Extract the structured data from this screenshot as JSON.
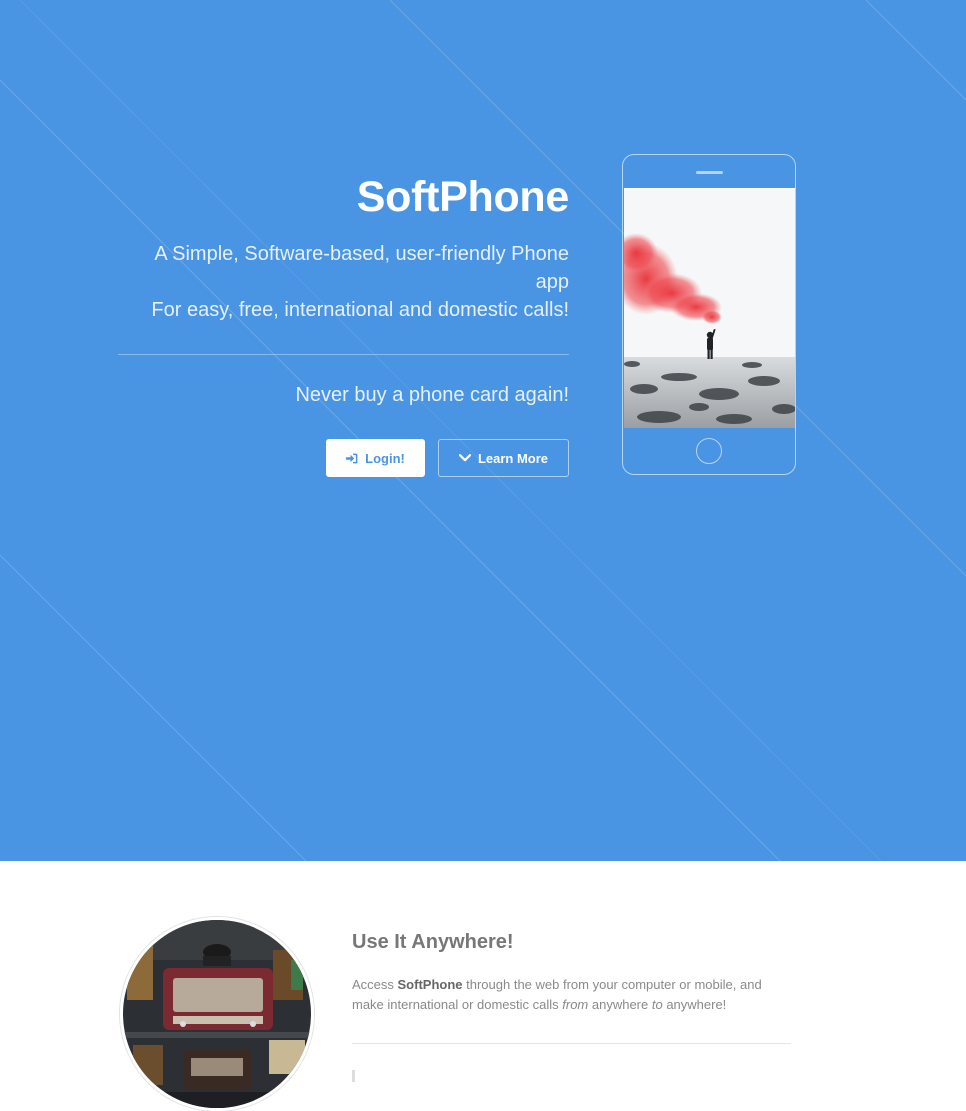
{
  "hero": {
    "title": "SoftPhone",
    "subtitle_line1": "A Simple, Software-based, user-friendly Phone app",
    "subtitle_line2": "For easy, free, international and domestic calls!",
    "tagline": "Never buy a phone card again!",
    "login_label": "Login!",
    "learn_more_label": "Learn More",
    "login_icon": "sign-in-icon",
    "learn_more_icon": "chevron-down-icon"
  },
  "feature": {
    "heading": "Use It Anywhere!",
    "body_part1": "Access ",
    "body_brand": "SoftPhone",
    "body_part2": " through the web from your computer or mobile, and make international or domestic calls ",
    "body_from": "from",
    "body_part3": " anywhere ",
    "body_to": "to",
    "body_part4": " anywhere!"
  },
  "colors": {
    "hero_background": "#4a95e3",
    "button_text": "#4a95e3",
    "smoke": "#e8323a"
  }
}
